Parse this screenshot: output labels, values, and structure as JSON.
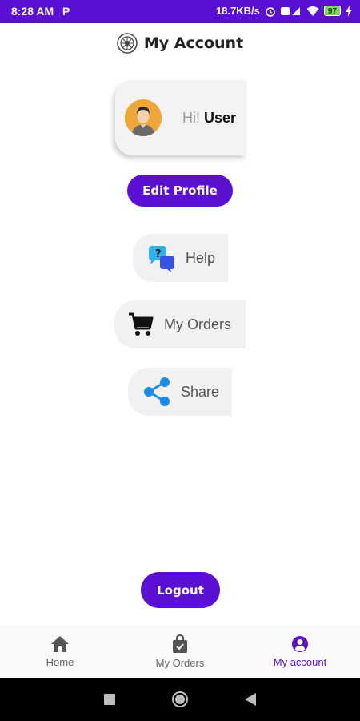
{
  "status_bar": {
    "time": "8:28 AM",
    "app_icon": "P",
    "speed": "18.7KB/s",
    "battery": "97",
    "bg_color": "#5b0fd3"
  },
  "header": {
    "title": "My Account",
    "logo_icon": "logo-icon"
  },
  "profile": {
    "greeting": "Hi!",
    "name": "User"
  },
  "buttons": {
    "edit_profile": "Edit Profile",
    "logout": "Logout",
    "accent_color": "#5b0fd3"
  },
  "menu": {
    "help": "Help",
    "orders": "My Orders",
    "share": "Share"
  },
  "bottom_nav": {
    "items": [
      {
        "label": "Home",
        "icon": "home-icon"
      },
      {
        "label": "My Orders",
        "icon": "shopping-bag-icon"
      },
      {
        "label": "My account",
        "icon": "account-icon"
      }
    ],
    "active_color": "#5b0fd3"
  }
}
